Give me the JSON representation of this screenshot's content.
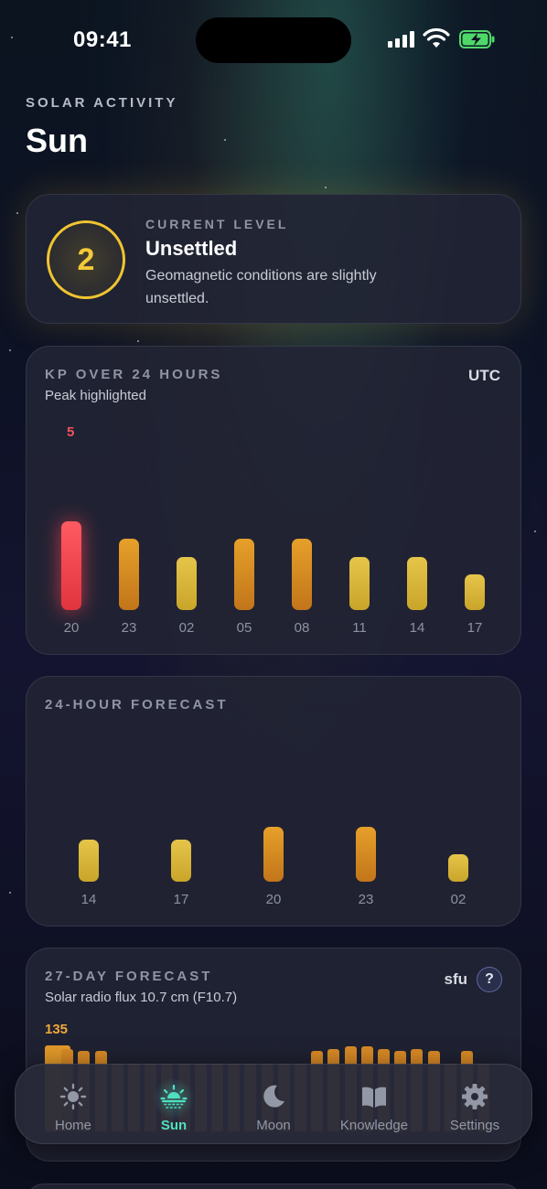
{
  "status": {
    "time": "09:41"
  },
  "header": {
    "eyebrow": "SOLAR ACTIVITY",
    "title": "Sun"
  },
  "level": {
    "eyebrow": "CURRENT LEVEL",
    "value": "2",
    "name": "Unsettled",
    "description": "Geomagnetic conditions are slightly unsettled."
  },
  "kp": {
    "eyebrow": "KP OVER 24 HOURS",
    "subtitle": "Peak highlighted",
    "tz": "UTC",
    "peak_label": "5"
  },
  "forecast24": {
    "eyebrow": "24-HOUR FORECAST"
  },
  "forecast27": {
    "eyebrow": "27-DAY FORECAST",
    "subtitle": "Solar radio flux 10.7 cm (F10.7)",
    "unit": "sfu",
    "help": "?",
    "max_label": "135"
  },
  "tabs": [
    {
      "label": "Home",
      "icon": "sun-outline-icon"
    },
    {
      "label": "Sun",
      "icon": "sunrise-icon"
    },
    {
      "label": "Moon",
      "icon": "moon-icon"
    },
    {
      "label": "Knowledge",
      "icon": "book-icon"
    },
    {
      "label": "Settings",
      "icon": "gear-icon"
    }
  ],
  "colors": {
    "accent": "#4fe0c0",
    "level": "#f0c430",
    "peak": "#f3525c",
    "high": "#e6a02a",
    "low": "#e5c54a"
  },
  "chart_data": [
    {
      "type": "bar",
      "categories": [
        "20",
        "23",
        "02",
        "05",
        "08",
        "11",
        "14",
        "17"
      ],
      "values": [
        5,
        4,
        3,
        4,
        4,
        3,
        3,
        2
      ],
      "peak_index": 0
    },
    {
      "type": "bar",
      "categories": [
        "14",
        "17",
        "20",
        "23",
        "02"
      ],
      "values": [
        2.3,
        2.3,
        3,
        3,
        1.5
      ]
    },
    {
      "type": "bar",
      "max": 135,
      "values": [
        135,
        128,
        124,
        124,
        100,
        100,
        100,
        100,
        100,
        100,
        100,
        100,
        100,
        100,
        100,
        100,
        124,
        128,
        133,
        133,
        128,
        124,
        128,
        124,
        100,
        124,
        100
      ]
    }
  ]
}
